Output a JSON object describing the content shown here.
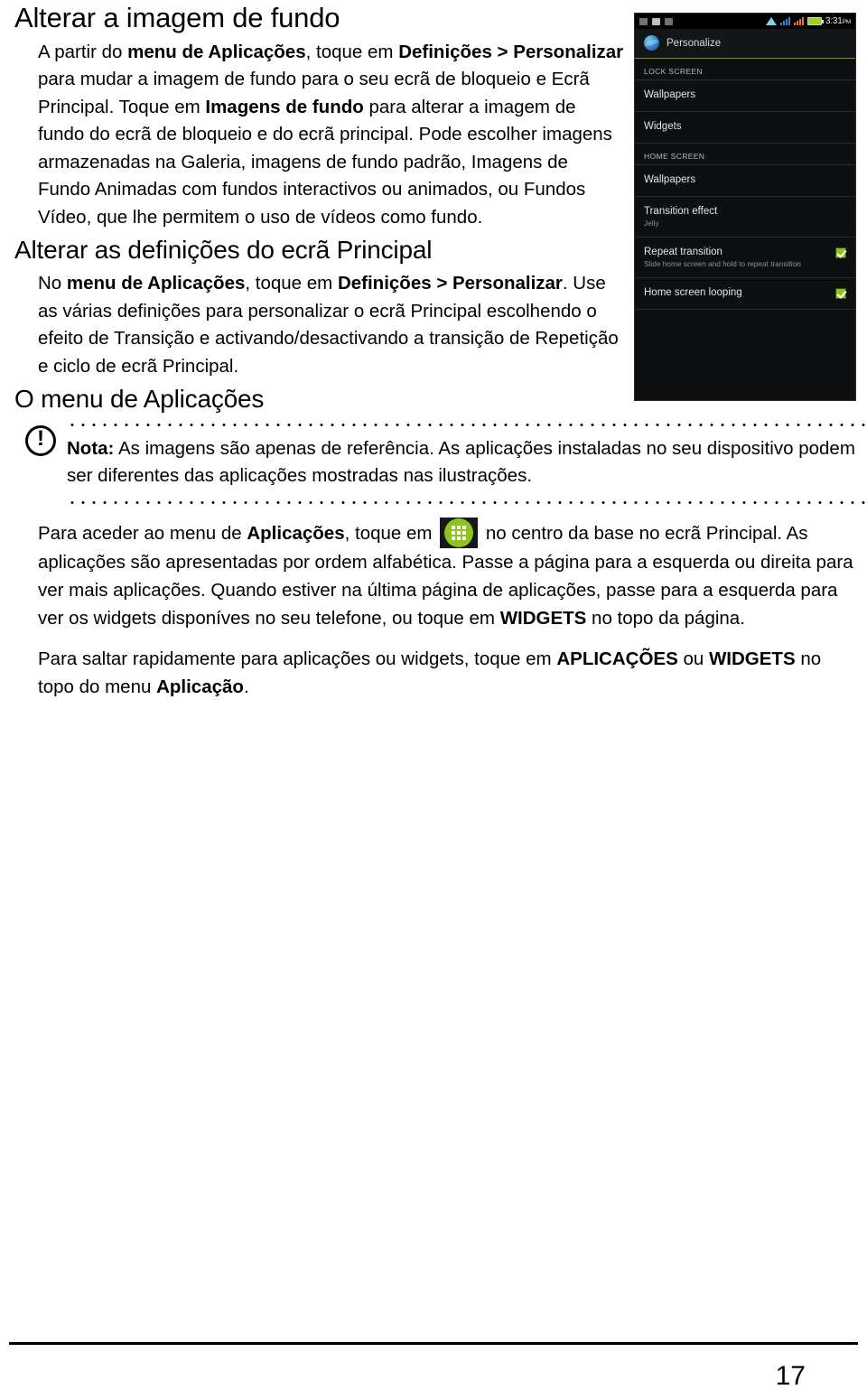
{
  "document": {
    "page_number": "17"
  },
  "sections": {
    "heading1": "Alterar a imagem de fundo",
    "heading2": "Alterar as definições do ecrã Principal",
    "heading3": "O menu de Aplicações"
  },
  "paragraphs": {
    "p1_part1": "A partir do ",
    "p1_bold1": "menu de Aplicações",
    "p1_part2": ", toque em ",
    "p1_bold2": "Definições > Personalizar",
    "p1_part3": " para mudar a imagem de fundo para o seu ecrã de bloqueio e Ecrã Principal. Toque em ",
    "p1_bold3": "Imagens de fundo",
    "p1_part4": " para alterar a imagem de fundo do ecrã de bloqueio e do ecrã principal. Pode escolher imagens armazenadas na Galeria, imagens de fundo padrão, Imagens de Fundo Animadas com fundos interactivos ou animados, ou Fundos Vídeo, que lhe permitem o uso de vídeos como fundo.",
    "p2_part1": "No ",
    "p2_bold1": "menu de Aplicações",
    "p2_part2": ", toque em ",
    "p2_bold2": "Definições > Personalizar",
    "p2_part3": ". Use as várias definições para personalizar o ecrã Principal escolhendo o efeito de Transição e activando/desactivando a transição de Repetição e ciclo de ecrã Principal.",
    "p4_part1": "Para aceder ao menu de ",
    "p4_bold1": "Aplicações",
    "p4_part2": ", toque em ",
    "p4_part3": " no centro da base no ecrã Principal. As aplicações são apresentadas por ordem alfabética. Passe a página para a esquerda ou direita para ver mais aplicações. Quando estiver na última página de aplicações, passe para a esquerda para ver os widgets disponíves no seu telefone, ou toque em ",
    "p4_bold2": "WIDGETS",
    "p4_part4": " no topo da página.",
    "p5_part1": "Para saltar rapidamente para aplicações ou widgets, toque em ",
    "p5_bold1": "APLICAÇÕES",
    "p5_part2": " ou ",
    "p5_bold2": "WIDGETS",
    "p5_part3": " no topo do menu ",
    "p5_bold3": "Aplicação",
    "p5_part4": "."
  },
  "note": {
    "icon": "exclamation-circle-icon",
    "label": "Nota:",
    "text": " As imagens são apenas de referência. As aplicações instaladas no seu dispositivo podem ser diferentes das aplicações mostradas nas ilustrações."
  },
  "phone_screenshot": {
    "statusbar": {
      "clock_time": "3:31",
      "clock_ampm": "PM",
      "left_icons": [
        "sim-card-icon",
        "screenshot-image-icon",
        "sd-card-icon"
      ],
      "right_icons": [
        "wifi-icon",
        "signal-bars-icon",
        "signal-bars-alt-icon",
        "battery-icon"
      ]
    },
    "header": {
      "icon": "personalize-globe-icon",
      "title": "Personalize"
    },
    "sections": [
      {
        "label": "LOCK SCREEN",
        "rows": [
          {
            "label": "Wallpapers",
            "sub": "",
            "checked": false
          },
          {
            "label": "Widgets",
            "sub": "",
            "checked": false
          }
        ]
      },
      {
        "label": "HOME SCREEN",
        "rows": [
          {
            "label": "Wallpapers",
            "sub": "",
            "checked": false
          },
          {
            "label": "Transition effect",
            "sub": "Jelly",
            "checked": false
          },
          {
            "label": "Repeat transition",
            "sub": "Slide home screen and hold to repeat transition",
            "checked": true
          },
          {
            "label": "Home screen looping",
            "sub": "",
            "checked": true
          }
        ]
      }
    ]
  },
  "icons": {
    "apps_menu_icon": "apps-grid-icon"
  },
  "colors": {
    "accent_green": "#8cc31e",
    "phone_bg": "#0d0f10",
    "header_rule": "#6f9b12"
  }
}
